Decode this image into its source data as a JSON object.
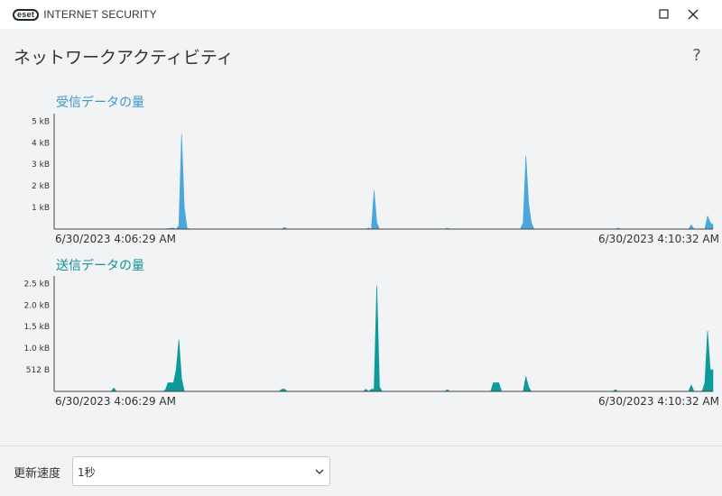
{
  "window": {
    "logo_badge": "eset",
    "app_name": "INTERNET SECURITY",
    "maximize_icon": "maximize-icon",
    "close_icon": "close-icon"
  },
  "page": {
    "title": "ネットワークアクティビティ",
    "help": "?"
  },
  "colors": {
    "received": "#4aa6dc",
    "sent": "#0c9a9a",
    "axis": "#444444"
  },
  "chart_data": [
    {
      "type": "area",
      "title": "受信データの量",
      "ytick_labels": [
        "5 kB",
        "4 kB",
        "3 kB",
        "2 kB",
        "1 kB"
      ],
      "ytick_values": [
        5,
        4,
        3,
        2,
        1
      ],
      "ylim": [
        0,
        5.1
      ],
      "x_range": [
        "6/30/2023 4:06:29 AM",
        "6/30/2023 4:10:32 AM"
      ],
      "x_start": "6/30/2023 4:06:29 AM",
      "x_end": "6/30/2023 4:10:32 AM",
      "ylabel_unit": "kB",
      "points": [
        [
          0,
          0
        ],
        [
          40,
          0
        ],
        [
          44,
          0.05
        ],
        [
          45,
          0
        ],
        [
          46,
          0.15
        ],
        [
          47,
          4.4
        ],
        [
          48,
          1.0
        ],
        [
          49,
          0.05
        ],
        [
          50,
          0
        ],
        [
          84,
          0
        ],
        [
          85,
          0.08
        ],
        [
          86,
          0
        ],
        [
          115,
          0
        ],
        [
          116,
          0.05
        ],
        [
          117,
          0
        ],
        [
          118,
          1.8
        ],
        [
          119,
          0.3
        ],
        [
          120,
          0
        ],
        [
          144,
          0
        ],
        [
          145,
          0.04
        ],
        [
          146,
          0
        ],
        [
          172,
          0
        ],
        [
          173,
          0.3
        ],
        [
          174,
          3.4
        ],
        [
          175,
          1.2
        ],
        [
          176,
          0.3
        ],
        [
          177,
          0
        ],
        [
          207,
          0
        ],
        [
          208,
          0.04
        ],
        [
          209,
          0
        ],
        [
          234,
          0
        ],
        [
          235,
          0.2
        ],
        [
          236,
          0
        ],
        [
          240,
          0
        ],
        [
          241,
          0.6
        ],
        [
          242,
          0.3
        ],
        [
          243,
          0.2
        ]
      ]
    },
    {
      "type": "area",
      "title": "送信データの量",
      "ytick_labels": [
        "2.5 kB",
        "2.0 kB",
        "1.5 kB",
        "1.0 kB",
        "512 B"
      ],
      "ytick_values": [
        2.5,
        2.0,
        1.5,
        1.0,
        0.5
      ],
      "ylim": [
        0,
        2.55
      ],
      "x_range": [
        "6/30/2023 4:06:29 AM",
        "6/30/2023 4:10:32 AM"
      ],
      "x_start": "6/30/2023 4:06:29 AM",
      "x_end": "6/30/2023 4:10:32 AM",
      "ylabel_unit": "kB",
      "points": [
        [
          0,
          0
        ],
        [
          21,
          0
        ],
        [
          22,
          0.08
        ],
        [
          23,
          0
        ],
        [
          40,
          0
        ],
        [
          41,
          0.03
        ],
        [
          42,
          0.2
        ],
        [
          44,
          0.2
        ],
        [
          45,
          0.5
        ],
        [
          46,
          1.2
        ],
        [
          47,
          0.3
        ],
        [
          48,
          0
        ],
        [
          83,
          0
        ],
        [
          84,
          0.05
        ],
        [
          85,
          0.05
        ],
        [
          86,
          0
        ],
        [
          114,
          0
        ],
        [
          115,
          0.05
        ],
        [
          116,
          0
        ],
        [
          117,
          0.05
        ],
        [
          118,
          0.05
        ],
        [
          119,
          2.45
        ],
        [
          120,
          0.1
        ],
        [
          121,
          0
        ],
        [
          144,
          0
        ],
        [
          145,
          0.04
        ],
        [
          146,
          0
        ],
        [
          161,
          0
        ],
        [
          162,
          0.2
        ],
        [
          164,
          0.2
        ],
        [
          165,
          0
        ],
        [
          173,
          0
        ],
        [
          174,
          0.35
        ],
        [
          175,
          0.1
        ],
        [
          176,
          0
        ],
        [
          206,
          0
        ],
        [
          207,
          0.04
        ],
        [
          208,
          0
        ],
        [
          234,
          0
        ],
        [
          235,
          0.15
        ],
        [
          236,
          0
        ],
        [
          239,
          0
        ],
        [
          240,
          0.2
        ],
        [
          241,
          1.4
        ],
        [
          242,
          0.5
        ],
        [
          243,
          0.5
        ]
      ]
    }
  ],
  "footer": {
    "label": "更新速度",
    "select_value": "1秒"
  }
}
